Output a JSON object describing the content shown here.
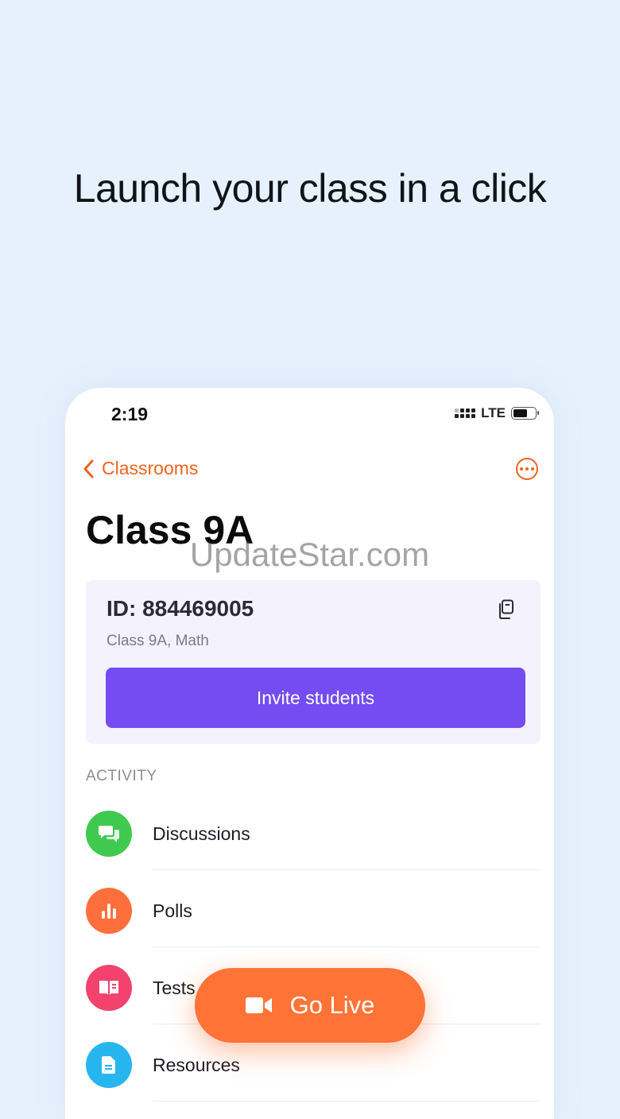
{
  "headline": "Launch your class in a click",
  "status": {
    "time": "2:19",
    "network": "LTE"
  },
  "nav": {
    "back_label": "Classrooms"
  },
  "watermark": "UpdateStar.com",
  "class": {
    "title": "Class 9A",
    "id_text": "ID: 884469005",
    "subtitle": "Class 9A, Math",
    "invite_label": "Invite students"
  },
  "activity": {
    "section_label": "ACTIVITY",
    "items": [
      {
        "label": "Discussions",
        "icon": "chat-bubbles-icon",
        "color": "#40c94f"
      },
      {
        "label": "Polls",
        "icon": "bar-chart-icon",
        "color": "#ff6f3c"
      },
      {
        "label": "Tests",
        "icon": "open-book-icon",
        "color": "#f3426d"
      },
      {
        "label": "Resources",
        "icon": "document-icon",
        "color": "#27b5ef"
      }
    ]
  },
  "go_live": {
    "label": "Go Live",
    "icon": "video-camera-icon"
  },
  "colors": {
    "accent": "#ee6420",
    "primary": "#744cf1",
    "background": "#e6f1fd"
  }
}
